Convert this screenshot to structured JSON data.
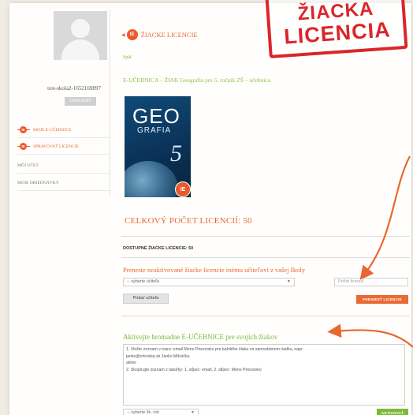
{
  "sidebar": {
    "username": "test-skola2-1652169897",
    "logout_label": "ODHLÁSIŤ",
    "items": [
      {
        "label": "MOJE E-UČEBNICE"
      },
      {
        "label": "SPRAVOVAŤ LICENCIE"
      },
      {
        "label": "MÔJ ÚČET"
      },
      {
        "label": "MOJE OBJEDNÁVKY"
      }
    ]
  },
  "main": {
    "header": "ŽIACKE LICENCIE",
    "back": "Späť",
    "book_title": "E-UČEBNICA – ŽIAK Geografia pre 5. ročník ZŠ – učebnica",
    "cover": {
      "title": "GEO",
      "subtitle": "GRAFIA",
      "number": "5"
    },
    "total_licences": "CELKOVÝ POČET LICENCIÍ: 50",
    "available": "DOSTUPNÉ ŽIACKE LICENCIE: 50",
    "transfer": {
      "title": "Preneste neaktivované žiacke licencie inému učiteľovi z vašej školy",
      "teacher_select": "-- vyberte učiteľa",
      "count_placeholder": "Počet licencií",
      "add_teacher": "Pridať učiteľa",
      "transfer_button": "PRENIESŤ LICENCIE"
    },
    "activate": {
      "title": "Aktivujte hromadne E-UČEBNICE pre svojich žiakov",
      "instructions": [
        "1. Vložte zoznam v tvare: email Meno Priezvisko pre každého žiaka na samostatnom riadku, napr.",
        "janko@orkviska.sk Janko Mrkvička",
        "alebo",
        "2. Skopírujte zoznam z tabuľky: 1. stĺpec: email, 2. stĺpec: Meno Priezvisko"
      ],
      "class_select": "-- vyberte šk. rok",
      "activate_button": "AKTIVOVAŤ"
    }
  },
  "stamp": {
    "line1": "ŽIACKA",
    "line2": "LICENCIA"
  },
  "colors": {
    "orange": "#e8682f",
    "green": "#7cbb3c",
    "stamp_red": "#d9262b"
  },
  "icons": [
    "ie-logo-icon",
    "chevron-down-icon",
    "avatar-placeholder-icon",
    "arrow-annotation-icon"
  ]
}
